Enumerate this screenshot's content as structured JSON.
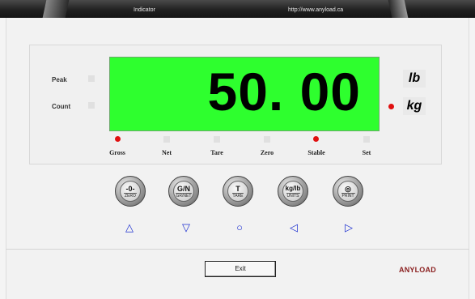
{
  "titlebar": {
    "title": "Indicator",
    "url": "http://www.anyload.ca"
  },
  "side_indicators": [
    {
      "label": "Peak"
    },
    {
      "label": "Count"
    }
  ],
  "display": {
    "weight": "50. 00",
    "color": "#2eff2e"
  },
  "units": [
    {
      "label": "lb",
      "active": false
    },
    {
      "label": "kg",
      "active": true
    }
  ],
  "status": [
    {
      "label": "Gross",
      "active": true
    },
    {
      "label": "Net",
      "active": false
    },
    {
      "label": "Tare",
      "active": false
    },
    {
      "label": "Zero",
      "active": false
    },
    {
      "label": "Stable",
      "active": true
    },
    {
      "label": "Set",
      "active": false
    }
  ],
  "keys": [
    {
      "symbol": "-0-",
      "caption": "ZERO",
      "icon": "zero-icon"
    },
    {
      "symbol": "G/N",
      "caption": "GR/NET",
      "icon": "gross-net-icon"
    },
    {
      "symbol": "T",
      "caption": "TARE",
      "icon": "tare-icon"
    },
    {
      "symbol": "kg/lb",
      "caption": "UNITS",
      "icon": "units-icon"
    },
    {
      "symbol": "◎",
      "caption": "PRINT",
      "icon": "print-icon"
    }
  ],
  "arrows": [
    {
      "glyph": "△",
      "icon": "up-arrow-icon"
    },
    {
      "glyph": "▽",
      "icon": "down-arrow-icon"
    },
    {
      "glyph": "○",
      "icon": "circle-icon"
    },
    {
      "glyph": "◁",
      "icon": "left-arrow-icon"
    },
    {
      "glyph": "▷",
      "icon": "right-arrow-icon"
    }
  ],
  "exit_label": "Exit",
  "logo_text": "ANYLOAD",
  "colors": {
    "active_led": "#e01010",
    "arrow": "#1c2fd0",
    "logo": "#8b2020"
  }
}
